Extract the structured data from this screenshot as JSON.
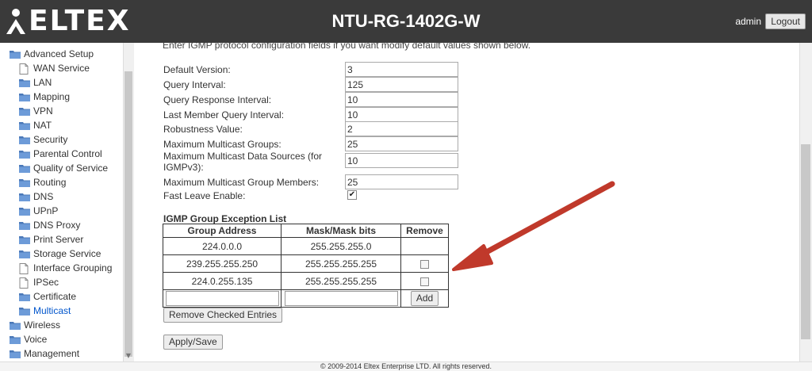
{
  "header": {
    "logo_text": "ELTEX",
    "device_title": "NTU-RG-1402G-W",
    "user": "admin",
    "logout_label": "Logout"
  },
  "sidebar": {
    "items": [
      {
        "label": "Advanced Setup",
        "icon": "folder-icon",
        "level": 0
      },
      {
        "label": "WAN Service",
        "icon": "page-icon",
        "level": 1
      },
      {
        "label": "LAN",
        "icon": "folder-icon",
        "level": 1
      },
      {
        "label": "Mapping",
        "icon": "folder-icon",
        "level": 1
      },
      {
        "label": "VPN",
        "icon": "folder-icon",
        "level": 1
      },
      {
        "label": "NAT",
        "icon": "folder-icon",
        "level": 1
      },
      {
        "label": "Security",
        "icon": "folder-icon",
        "level": 1
      },
      {
        "label": "Parental Control",
        "icon": "folder-icon",
        "level": 1
      },
      {
        "label": "Quality of Service",
        "icon": "folder-icon",
        "level": 1
      },
      {
        "label": "Routing",
        "icon": "folder-icon",
        "level": 1
      },
      {
        "label": "DNS",
        "icon": "folder-icon",
        "level": 1
      },
      {
        "label": "UPnP",
        "icon": "folder-icon",
        "level": 1
      },
      {
        "label": "DNS Proxy",
        "icon": "folder-icon",
        "level": 1
      },
      {
        "label": "Print Server",
        "icon": "folder-icon",
        "level": 1
      },
      {
        "label": "Storage Service",
        "icon": "folder-icon",
        "level": 1
      },
      {
        "label": "Interface Grouping",
        "icon": "page-icon",
        "level": 1
      },
      {
        "label": "IPSec",
        "icon": "page-icon",
        "level": 1
      },
      {
        "label": "Certificate",
        "icon": "folder-icon",
        "level": 1
      },
      {
        "label": "Multicast",
        "icon": "folder-icon",
        "level": 1,
        "active": true
      },
      {
        "label": "Wireless",
        "icon": "folder-icon",
        "level": 0
      },
      {
        "label": "Voice",
        "icon": "folder-icon",
        "level": 0
      },
      {
        "label": "Management",
        "icon": "folder-icon",
        "level": 0
      }
    ]
  },
  "main": {
    "intro": "Enter IGMP protocol configuration fields if you want modify default values shown below.",
    "fields": [
      {
        "label": "Default Version:",
        "value": "3"
      },
      {
        "label": "Query Interval:",
        "value": "125"
      },
      {
        "label": "Query Response Interval:",
        "value": "10"
      },
      {
        "label": "Last Member Query Interval:",
        "value": "10"
      },
      {
        "label": "Robustness Value:",
        "value": "2"
      },
      {
        "label": "Maximum Multicast Groups:",
        "value": "25"
      },
      {
        "label": "Maximum Multicast Data Sources (for IGMPv3):",
        "value": "10"
      },
      {
        "label": "Maximum Multicast Group Members:",
        "value": "25"
      }
    ],
    "fast_leave_label": "Fast Leave Enable:",
    "fast_leave_checked": true,
    "exception_title": "IGMP Group Exception List",
    "table_headers": [
      "Group Address",
      "Mask/Mask bits",
      "Remove"
    ],
    "table_rows": [
      {
        "address": "224.0.0.0",
        "mask": "255.255.255.0",
        "removable": false
      },
      {
        "address": "239.255.255.250",
        "mask": "255.255.255.255",
        "removable": true
      },
      {
        "address": "224.0.255.135",
        "mask": "255.255.255.255",
        "removable": true
      }
    ],
    "add_label": "Add",
    "remove_checked_label": "Remove Checked Entries",
    "apply_label": "Apply/Save"
  },
  "footer": {
    "copyright": "© 2009-2014 Eltex Enterprise LTD. All rights reserved."
  },
  "colors": {
    "header_bg": "#3a3a3a",
    "arrow": "#c0392b",
    "active_link": "#0055cc"
  }
}
